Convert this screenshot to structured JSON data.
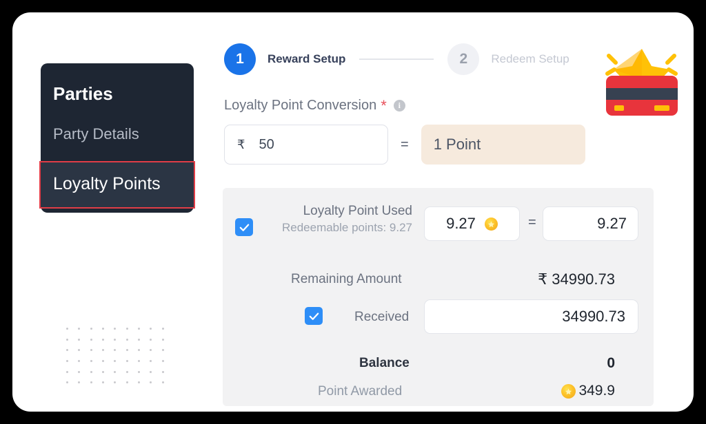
{
  "sidebar": {
    "items": [
      {
        "label": "Parties",
        "state": "header"
      },
      {
        "label": "Party Details",
        "state": "normal"
      },
      {
        "label": "Loyalty Points",
        "state": "active"
      }
    ],
    "active_border_color": "#e23d47",
    "background_color": "#1e2633"
  },
  "stepper": {
    "steps": [
      {
        "number": "1",
        "label": "Reward Setup",
        "state": "active"
      },
      {
        "number": "2",
        "label": "Redeem Setup",
        "state": "inactive"
      }
    ],
    "active_color": "#1a73e8"
  },
  "conversion": {
    "label": "Loyalty Point Conversion",
    "required_marker": "*",
    "info_glyph": "i",
    "currency_symbol": "₹",
    "amount": "50",
    "equals": "=",
    "points_label": "1 Point",
    "points_background": "#f6eadd"
  },
  "icons": {
    "gift_card": "loyalty-card-icon",
    "coin": "coin-star-icon",
    "check": "checkmark-icon",
    "info": "info-icon"
  },
  "summary": {
    "background_color": "#f2f2f3",
    "loyalty_point_used": {
      "checked": true,
      "label": "Loyalty Point Used",
      "sublabel": "Redeemable points: 9.27",
      "points_value": "9.27",
      "equals": "=",
      "amount_value": "9.27"
    },
    "remaining_amount": {
      "label": "Remaining Amount",
      "value": "₹ 34990.73"
    },
    "received": {
      "checked": true,
      "label": "Received",
      "value": "34990.73"
    },
    "balance": {
      "label": "Balance",
      "value": "0"
    },
    "point_awarded": {
      "label": "Point Awarded",
      "value": "349.9"
    }
  }
}
